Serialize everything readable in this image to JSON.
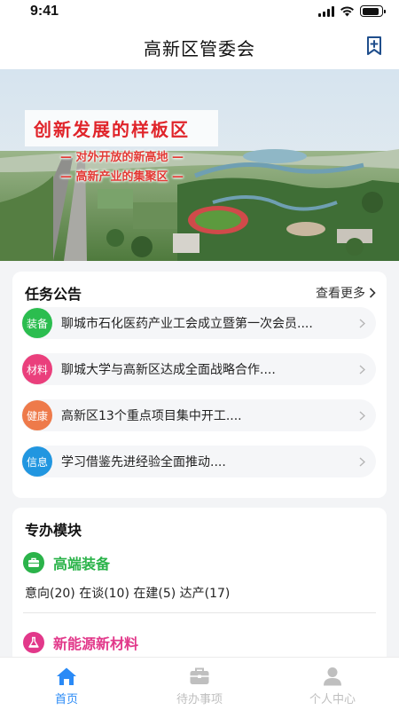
{
  "status": {
    "time": "9:41",
    "battery_level": 0.9
  },
  "header": {
    "title": "高新区管委会",
    "bookmark_icon": "bookmark-add-icon"
  },
  "banner": {
    "headline": "创新发展的样板区",
    "sub1": "— 对外开放的新高地 —",
    "sub2": "— 高新产业的集聚区 —",
    "accent": "#e0242a"
  },
  "notices": {
    "title": "任务公告",
    "more": "查看更多",
    "items": [
      {
        "badge": "装备",
        "color": "#2bbd4f",
        "text": "聊城市石化医药产业工会成立暨第一次会员...."
      },
      {
        "badge": "材料",
        "color": "#ea3f7c",
        "text": "聊城大学与高新区达成全面战略合作...."
      },
      {
        "badge": "健康",
        "color": "#ee7a4a",
        "text": "高新区13个重点项目集中开工...."
      },
      {
        "badge": "信息",
        "color": "#2196e0",
        "text": "学习借鉴先进经验全面推动...."
      }
    ]
  },
  "modules": {
    "title": "专办模块",
    "items": [
      {
        "name": "高端装备",
        "color": "#2bb34a",
        "icon": "briefcase-icon",
        "stats": "意向(20) 在谈(10)  在建(5) 达产(17)"
      },
      {
        "name": "新能源新材料",
        "color": "#e2388a",
        "icon": "flask-icon"
      }
    ]
  },
  "tabs": [
    {
      "label": "首页",
      "icon": "home-icon",
      "active": true
    },
    {
      "label": "待办事项",
      "icon": "todo-briefcase-icon",
      "active": false
    },
    {
      "label": "个人中心",
      "icon": "user-icon",
      "active": false
    }
  ],
  "colors": {
    "tab_active": "#2a8af6",
    "tab_inactive": "#bfbfbf"
  }
}
